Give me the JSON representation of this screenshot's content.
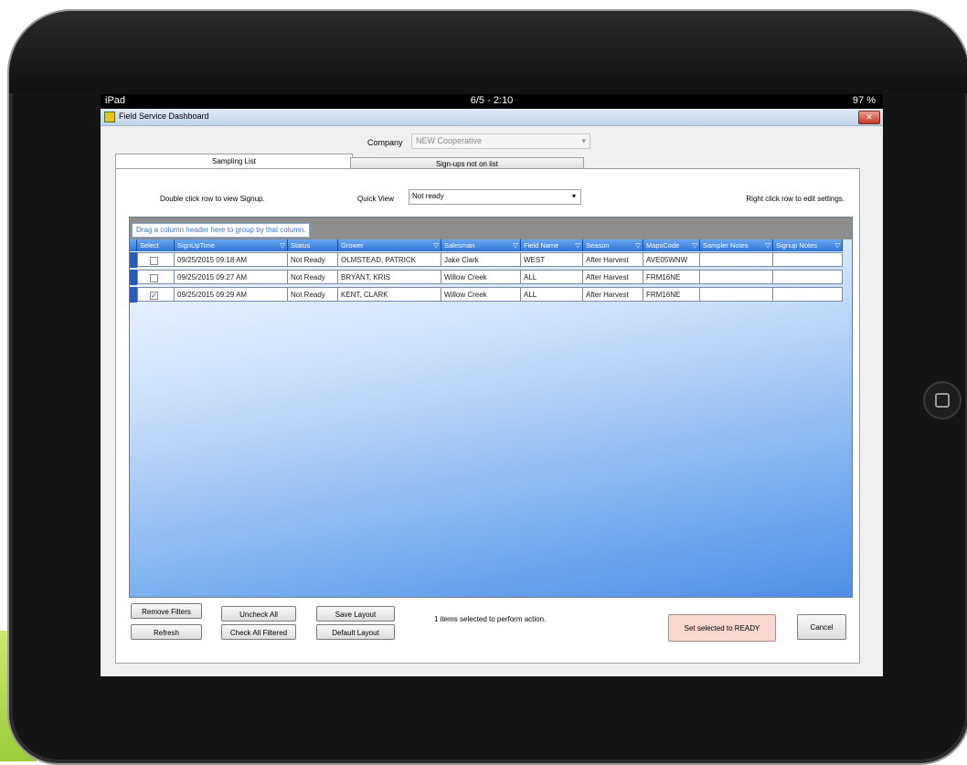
{
  "device": {
    "carrier": "iPad",
    "clock": "6/5 - 2:10",
    "battery": "97 %"
  },
  "window": {
    "title": "Field Service Dashboard",
    "close_label": "✕"
  },
  "company": {
    "label": "Company",
    "value": "NEW Cooperative"
  },
  "tabs": [
    {
      "label": "Sampling List"
    },
    {
      "label": "Sign-ups not on list"
    }
  ],
  "panel": {
    "hint_left": "Double click row to view Signup.",
    "quick_view_label": "Quick View",
    "quick_view_value": "Not ready",
    "hint_right": "Right click row to edit settings."
  },
  "grid": {
    "group_hint": "Drag a column header here to group by that column.",
    "columns": [
      "Select",
      "SignUpTime",
      "Status",
      "Grower",
      "Salesman",
      "Field Name",
      "Season",
      "MapsCode",
      "Sampler Notes",
      "Signup Notes"
    ],
    "rows": [
      {
        "checked": false,
        "signup_time": "09/25/2015 09:18 AM",
        "status": "Not Ready",
        "grower": "OLMSTEAD, PATRICK",
        "salesman": "Jake Clark",
        "field": "WEST",
        "season": "After Harvest",
        "maps": "AVE05WNW",
        "sampler_notes": "",
        "signup_notes": ""
      },
      {
        "checked": false,
        "signup_time": "09/25/2015 09:27 AM",
        "status": "Not Ready",
        "grower": "BRYANT, KRIS",
        "salesman": "Willow Creek",
        "field": "ALL",
        "season": "After Harvest",
        "maps": "FRM16NE",
        "sampler_notes": "",
        "signup_notes": ""
      },
      {
        "checked": true,
        "signup_time": "09/25/2015 09:29 AM",
        "status": "Not Ready",
        "grower": "KENT, CLARK",
        "salesman": "Willow Creek",
        "field": "ALL",
        "season": "After Harvest",
        "maps": "FRM16NE",
        "sampler_notes": "",
        "signup_notes": ""
      }
    ]
  },
  "buttons": {
    "remove_filters": "Remove Filters",
    "refresh": "Refresh",
    "uncheck_all": "Uncheck All",
    "check_all_filtered": "Check All Filtered",
    "save_layout": "Save Layout",
    "default_layout": "Default Layout",
    "set_ready": "Set selected to READY",
    "cancel": "Cancel"
  },
  "selection_info": "1 items selected to perform action.",
  "icons": {
    "filter": "▽",
    "dropdown": "▾",
    "wifi": "wifi-icon"
  },
  "colors": {
    "header_blue": "#2f74d8",
    "group_area": "#8d8d8d",
    "ready_button": "#fbd7d2"
  }
}
